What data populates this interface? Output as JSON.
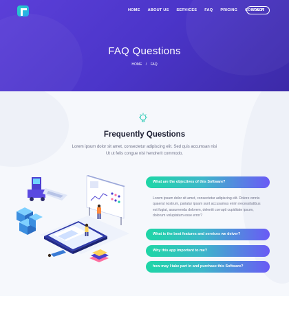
{
  "nav": {
    "items": [
      "HOME",
      "ABOUT US",
      "SERVICES",
      "FAQ",
      "PRICING",
      "CONTACT"
    ],
    "login": "LOG IN"
  },
  "hero": {
    "title": "FAQ Questions",
    "breadcrumb": [
      "HOME",
      "FAQ"
    ],
    "breadcrumb_sep": "/"
  },
  "section": {
    "title": "Frequently Questions",
    "desc": "Lorem ipsum dolor sit amet, consectetur adipiscing elit. Sed quis accumsan nisi Ut ut felis congue nisl hendrerit commodo."
  },
  "faq": {
    "items": [
      {
        "question": "What are the objectives of this Software?",
        "open": true
      },
      {
        "question": "What is the best features and services we deiver?",
        "open": false
      },
      {
        "question": "Why this app important to me?",
        "open": false
      },
      {
        "question": "how may I take part in and purchase this Software?",
        "open": false
      }
    ],
    "answer": "Lorem ipsum dolor sit amet, consectetur adipiscing elit. Dolore omnis quaerat nostrum, pariatur ipsam sunt accusamus enim necessitatibus est fugiat, assumenda dolorem, deleniti corrupti cupiditate ipsum, dolorum voluptatum esse error?"
  },
  "colors": {
    "hero_bg": "#4b35c9",
    "faq_gradient_start": "#1ed6a6",
    "faq_gradient_end": "#6a5af5"
  }
}
